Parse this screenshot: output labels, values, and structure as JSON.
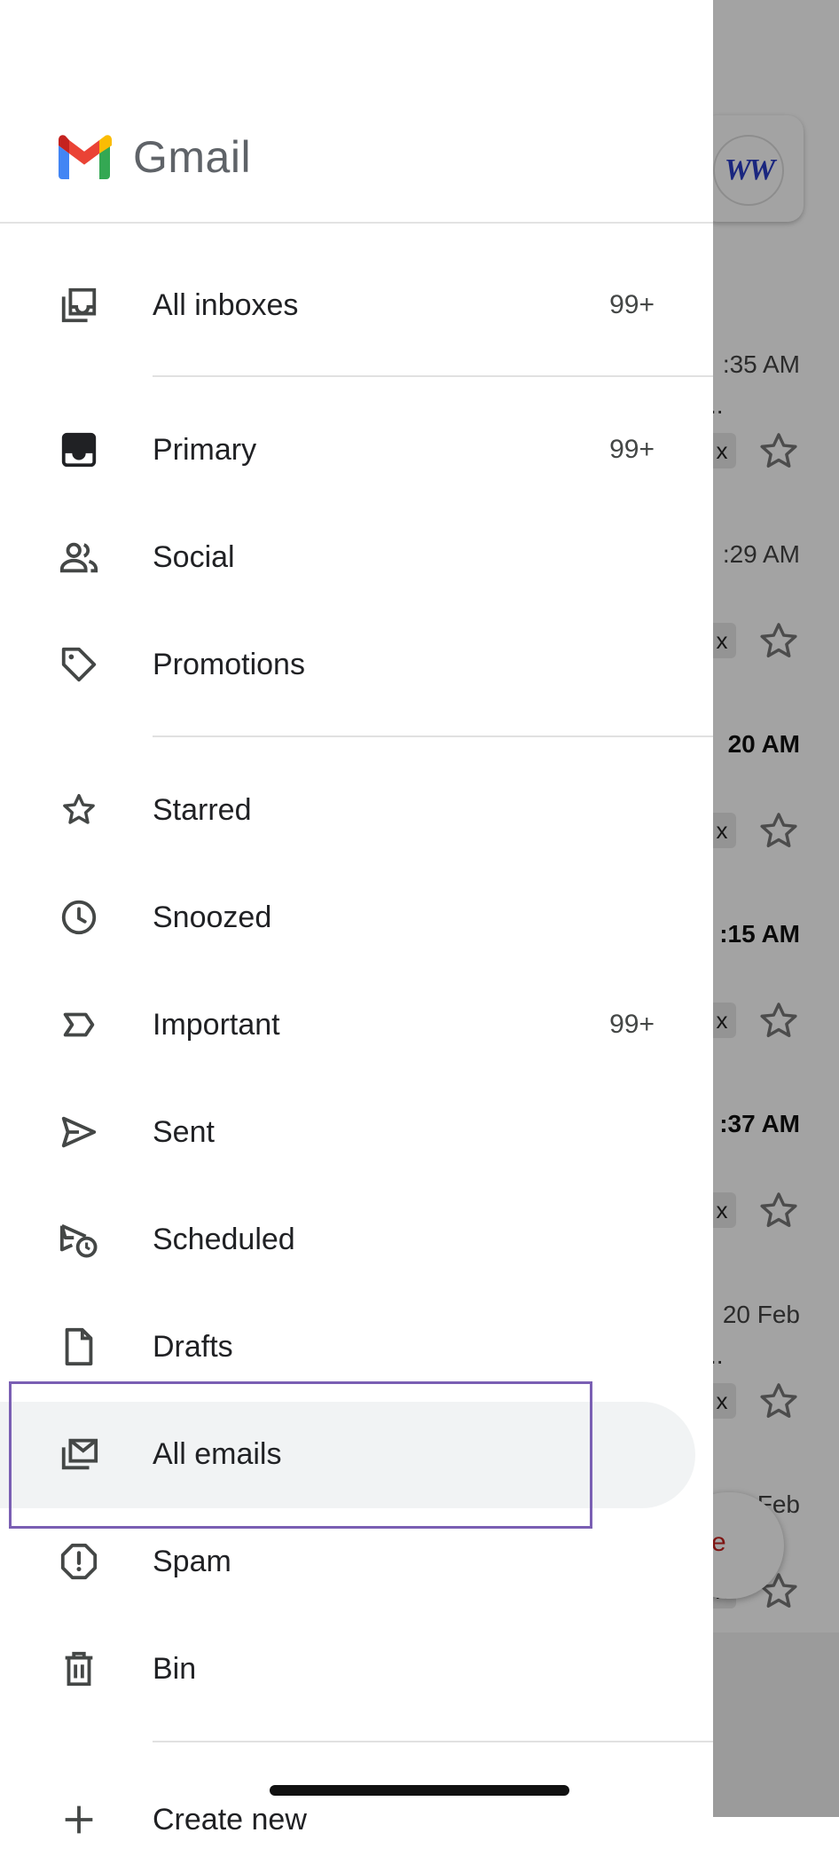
{
  "app": {
    "wordmark": "Gmail"
  },
  "account": {
    "avatar_text": "WW"
  },
  "nav": {
    "all_inboxes": {
      "label": "All inboxes",
      "count": "99+",
      "icon": "all-inboxes-icon"
    },
    "primary": {
      "label": "Primary",
      "count": "99+",
      "icon": "inbox-icon"
    },
    "social": {
      "label": "Social",
      "icon": "people-icon"
    },
    "promotions": {
      "label": "Promotions",
      "icon": "tag-icon"
    },
    "starred": {
      "label": "Starred",
      "icon": "star-icon"
    },
    "snoozed": {
      "label": "Snoozed",
      "icon": "clock-icon"
    },
    "important": {
      "label": "Important",
      "count": "99+",
      "icon": "label-important-icon"
    },
    "sent": {
      "label": "Sent",
      "icon": "send-icon"
    },
    "scheduled": {
      "label": "Scheduled",
      "icon": "scheduled-send-icon"
    },
    "drafts": {
      "label": "Drafts",
      "icon": "draft-icon"
    },
    "all_emails": {
      "label": "All emails",
      "icon": "all-mail-icon",
      "selected": true
    },
    "spam": {
      "label": "Spam",
      "icon": "spam-icon"
    },
    "bin": {
      "label": "Bin",
      "icon": "trash-icon"
    },
    "create_new": {
      "label": "Create new",
      "icon": "plus-icon"
    }
  },
  "background_list": {
    "times": [
      ":35 AM",
      ":29 AM",
      "20 AM",
      ":15 AM",
      ":37 AM",
      "20 Feb",
      "Feb"
    ],
    "chip_text": "x",
    "ellipsis": "..",
    "compose_partial": "e"
  },
  "colors": {
    "selected_bg": "#f1f3f4",
    "selection_outline": "#7a5fb3",
    "compose_accent": "#c5221f"
  }
}
